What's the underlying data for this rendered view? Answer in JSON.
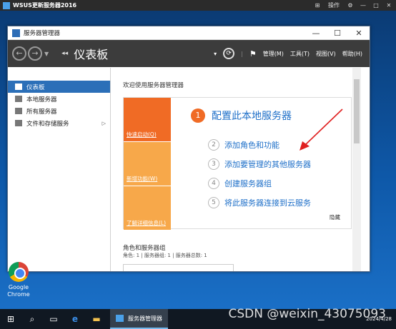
{
  "rdp": {
    "title": "WSUS更新服务器2016",
    "controls": [
      "⊞",
      "操作",
      "⚙",
      "—",
      "□",
      "✕"
    ]
  },
  "window": {
    "title": "服务器管理器",
    "min": "—",
    "max": "☐",
    "close": "✕"
  },
  "cmdbar": {
    "breadcrumb": "仪表板",
    "back": "←",
    "forward": "→",
    "menus": [
      "管理(M)",
      "工具(T)",
      "视图(V)",
      "帮助(H)"
    ]
  },
  "sidebar": {
    "items": [
      {
        "label": "仪表板",
        "active": true
      },
      {
        "label": "本地服务器"
      },
      {
        "label": "所有服务器"
      },
      {
        "label": "文件和存储服务",
        "caret": "▷"
      }
    ]
  },
  "main": {
    "welcome": "欢迎使用服务器管理器",
    "quick_start": [
      "快速启动(Q)",
      "新增功能(W)",
      "了解详细信息(L)"
    ],
    "steps": [
      {
        "num": "1",
        "label": "配置此本地服务器"
      },
      {
        "num": "2",
        "label": "添加角色和功能"
      },
      {
        "num": "3",
        "label": "添加要管理的其他服务器"
      },
      {
        "num": "4",
        "label": "创建服务器组"
      },
      {
        "num": "5",
        "label": "将此服务器连接到云服务"
      }
    ],
    "hide": "隐藏",
    "roles_title": "角色和服务器组",
    "roles_sub": "角色: 1 | 服务器组: 1 | 服务器总数: 1"
  },
  "desktop": {
    "chrome_label_1": "Google",
    "chrome_label_2": "Chrome"
  },
  "taskbar": {
    "app": "服务器管理器",
    "date": "2024/4/28"
  },
  "watermark": "CSDN @weixin_43075093",
  "colors": {
    "accent": "#f06b25",
    "link": "#1e6fc8",
    "active": "#2b6fb8"
  }
}
